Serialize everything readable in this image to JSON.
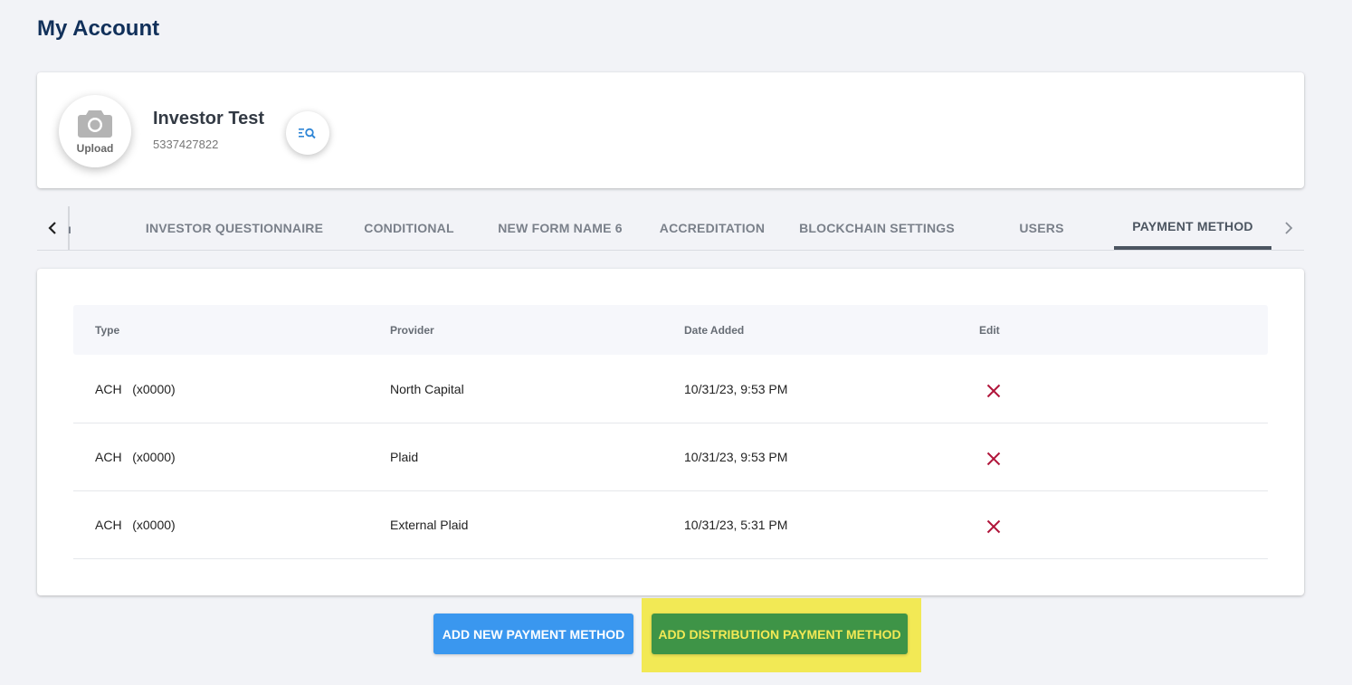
{
  "page": {
    "title": "My Account"
  },
  "profile": {
    "avatar_label": "Upload",
    "name": "Investor Test",
    "id": "5337427822"
  },
  "tabs": {
    "cut_label": "ı",
    "items": [
      {
        "label": "INVESTOR QUESTIONNAIRE"
      },
      {
        "label": "CONDITIONAL"
      },
      {
        "label": "NEW FORM NAME 6"
      },
      {
        "label": "ACCREDITATION"
      },
      {
        "label": "BLOCKCHAIN SETTINGS"
      },
      {
        "label": "USERS"
      },
      {
        "label": "PAYMENT METHOD"
      }
    ],
    "active": "PAYMENT METHOD"
  },
  "table": {
    "headers": [
      "Type",
      "Provider",
      "Date Added",
      "Edit"
    ],
    "rows": [
      {
        "type": "ACH   (x0000)",
        "provider": "North Capital",
        "date": "10/31/23, 9:53 PM"
      },
      {
        "type": "ACH   (x0000)",
        "provider": "Plaid",
        "date": "10/31/23, 9:53 PM"
      },
      {
        "type": "ACH   (x0000)",
        "provider": "External Plaid",
        "date": "10/31/23, 5:31 PM"
      }
    ]
  },
  "buttons": {
    "add_new": "ADD NEW PAYMENT METHOD",
    "add_distribution": "ADD DISTRIBUTION PAYMENT METHOD"
  },
  "colors": {
    "primary": "#3a97ef",
    "success": "#3e9447",
    "highlight": "#f2e955",
    "delete": "#b0153a",
    "title": "#11305a"
  },
  "icons": {
    "avatar": "camera-icon",
    "details": "list-search-icon",
    "delete": "close-icon",
    "tab_left": "chevron-left-icon",
    "tab_right": "chevron-right-icon"
  }
}
